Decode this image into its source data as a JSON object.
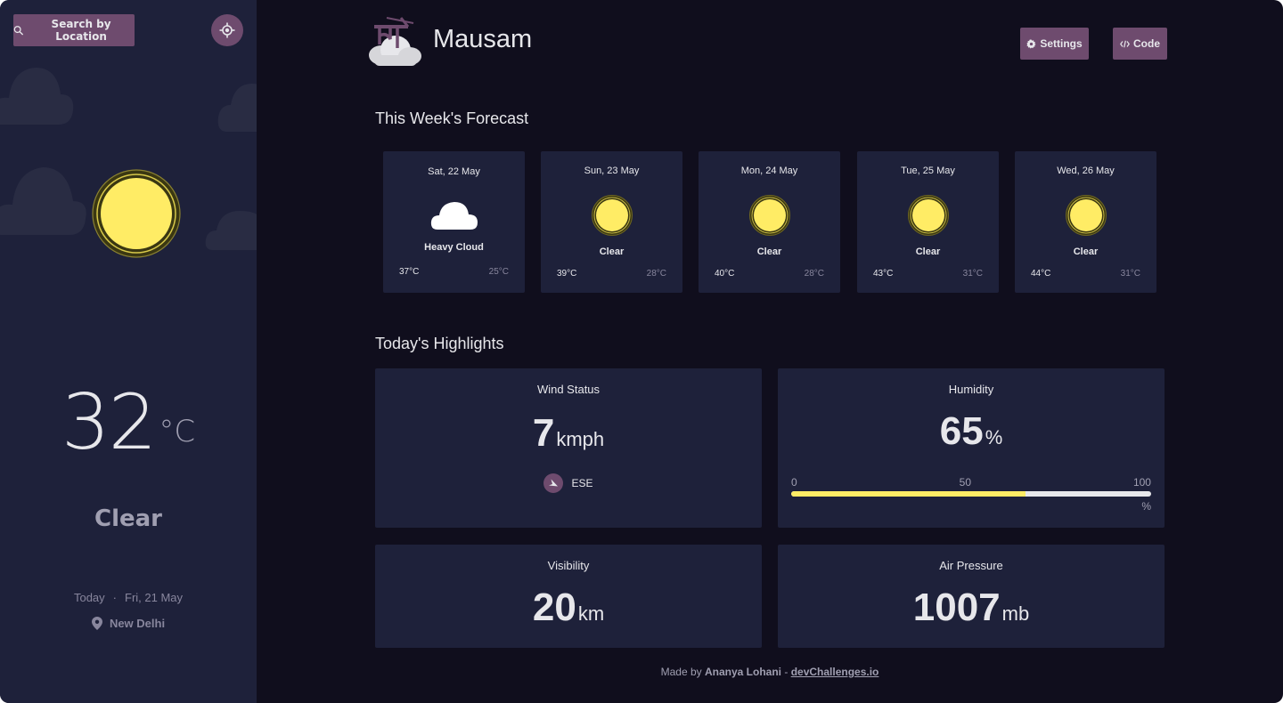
{
  "sidebar": {
    "search_label": "Search by Location",
    "temperature": "32",
    "temperature_unit": "°C",
    "condition": "Clear",
    "today_label": "Today",
    "separator": "·",
    "date": "Fri, 21 May",
    "location": "New Delhi"
  },
  "header": {
    "brand": "Mausam",
    "settings_label": "Settings",
    "code_label": "Code"
  },
  "forecast": {
    "title": "This Week's Forecast",
    "days": [
      {
        "date": "Sat, 22 May",
        "icon": "cloud-icon",
        "condition": "Heavy Cloud",
        "max": "37°C",
        "min": "25°C"
      },
      {
        "date": "Sun, 23 May",
        "icon": "sun-icon",
        "condition": "Clear",
        "max": "39°C",
        "min": "28°C"
      },
      {
        "date": "Mon, 24 May",
        "icon": "sun-icon",
        "condition": "Clear",
        "max": "40°C",
        "min": "28°C"
      },
      {
        "date": "Tue, 25 May",
        "icon": "sun-icon",
        "condition": "Clear",
        "max": "43°C",
        "min": "31°C"
      },
      {
        "date": "Wed, 26 May",
        "icon": "sun-icon",
        "condition": "Clear",
        "max": "44°C",
        "min": "31°C"
      }
    ]
  },
  "highlights": {
    "title": "Today's Highlights",
    "wind": {
      "label": "Wind Status",
      "value": "7",
      "unit": "kmph",
      "direction": "ESE"
    },
    "humidity": {
      "label": "Humidity",
      "value": "65",
      "unit": "%",
      "scale_min": "0",
      "scale_mid": "50",
      "scale_max": "100",
      "scale_unit": "%",
      "level_percent": 65
    },
    "visibility": {
      "label": "Visibility",
      "value": "20",
      "unit": "km"
    },
    "pressure": {
      "label": "Air Pressure",
      "value": "1007",
      "unit": "mb"
    }
  },
  "footer": {
    "made_by": "Made by",
    "author": "Ananya Lohani",
    "dash": "-",
    "link": "devChallenges.io"
  },
  "colors": {
    "background": "#100e1d",
    "panel": "#1e213a",
    "accent": "#6e4b6e",
    "sun": "#ffec65",
    "text": "#e7e7eb",
    "muted": "#a09fb1"
  }
}
